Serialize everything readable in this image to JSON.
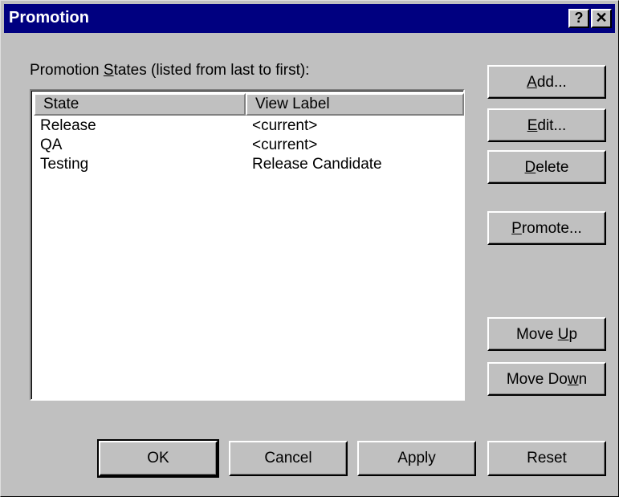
{
  "window": {
    "title": "Promotion",
    "help_glyph": "?",
    "close_glyph": "✕"
  },
  "states_label": {
    "pre": "Promotion ",
    "key": "S",
    "post": "tates (listed from last to first):"
  },
  "table": {
    "columns": [
      "State",
      "View Label"
    ],
    "rows": [
      {
        "state": "Release",
        "view_label": "<current>"
      },
      {
        "state": "QA",
        "view_label": "<current>"
      },
      {
        "state": "Testing",
        "view_label": "Release Candidate"
      }
    ]
  },
  "buttons": {
    "add": {
      "pre": "",
      "key": "A",
      "post": "dd..."
    },
    "edit": {
      "pre": "",
      "key": "E",
      "post": "dit..."
    },
    "delete": {
      "pre": "",
      "key": "D",
      "post": "elete"
    },
    "promote": {
      "pre": "",
      "key": "P",
      "post": "romote..."
    },
    "move_up": {
      "pre": "Move ",
      "key": "U",
      "post": "p"
    },
    "move_down": {
      "pre": "Move Do",
      "key": "w",
      "post": "n"
    },
    "ok": "OK",
    "cancel": "Cancel",
    "apply": "Apply",
    "reset": "Reset"
  }
}
